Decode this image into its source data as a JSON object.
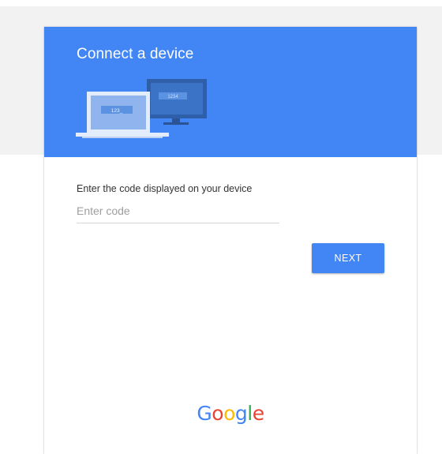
{
  "header": {
    "title": "Connect a device",
    "laptop_screen_text": "123_",
    "monitor_screen_text": "1234"
  },
  "form": {
    "label": "Enter the code displayed on your device",
    "code_value": "",
    "code_placeholder": "Enter code",
    "next_label": "NEXT"
  },
  "footer": {
    "logo_letters": [
      "G",
      "o",
      "o",
      "g",
      "l",
      "e"
    ],
    "logo_colors": [
      "#4285f4",
      "#ea4335",
      "#fbbc05",
      "#4285f4",
      "#34a853",
      "#ea4335"
    ]
  },
  "colors": {
    "accent": "#4285f4",
    "page_band": "#f2f2f2"
  }
}
